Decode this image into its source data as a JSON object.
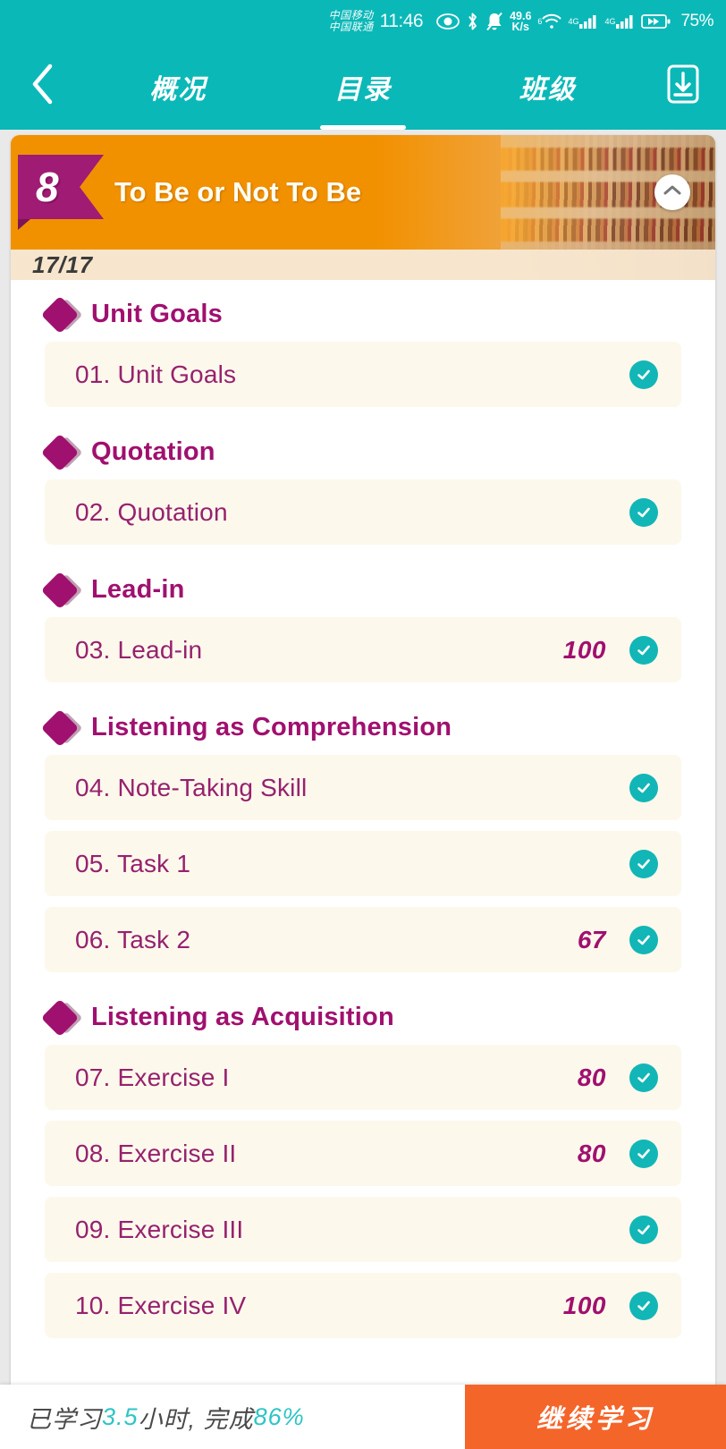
{
  "statusbar": {
    "carrier_line1": "中国移动",
    "carrier_line2": "中国联通",
    "time": "11:46",
    "netspeed_value": "49.6",
    "netspeed_unit": "K/s",
    "wifi_label": "6",
    "sim1_label": "4G",
    "sim2_label": "4G",
    "battery": "75%"
  },
  "navbar": {
    "back_icon": "chevron-left-icon",
    "tabs": [
      {
        "label": "概况",
        "active": false
      },
      {
        "label": "目录",
        "active": true
      },
      {
        "label": "班级",
        "active": false
      }
    ],
    "download_icon": "download-icon"
  },
  "unit": {
    "number": "8",
    "title": "To Be or Not To Be",
    "collapse_icon": "chevron-up-icon",
    "progress": "17/17"
  },
  "sections": [
    {
      "title": "Unit Goals",
      "items": [
        {
          "label": "01. Unit Goals",
          "score": "",
          "completed": true
        }
      ]
    },
    {
      "title": "Quotation",
      "items": [
        {
          "label": "02. Quotation",
          "score": "",
          "completed": true
        }
      ]
    },
    {
      "title": "Lead-in",
      "items": [
        {
          "label": "03. Lead-in",
          "score": "100",
          "completed": true
        }
      ]
    },
    {
      "title": "Listening as Comprehension",
      "items": [
        {
          "label": "04. Note-Taking Skill",
          "score": "",
          "completed": true
        },
        {
          "label": "05. Task 1",
          "score": "",
          "completed": true
        },
        {
          "label": "06. Task 2",
          "score": "67",
          "completed": true
        }
      ]
    },
    {
      "title": "Listening as Acquisition",
      "items": [
        {
          "label": "07. Exercise I",
          "score": "80",
          "completed": true
        },
        {
          "label": "08. Exercise II",
          "score": "80",
          "completed": true
        },
        {
          "label": "09. Exercise III",
          "score": "",
          "completed": true
        },
        {
          "label": "10. Exercise IV",
          "score": "100",
          "completed": true
        }
      ]
    }
  ],
  "footer": {
    "studied_prefix": "已学习 ",
    "studied_hours": "3.5",
    "studied_mid": " 小时, 完成 ",
    "completion": "86%",
    "continue_label": "继续学习"
  },
  "colors": {
    "teal": "#0bb8b8",
    "magenta": "#a0106f",
    "orange": "#f29100",
    "button_orange": "#f4652a",
    "row_bg": "#fdf8ec"
  }
}
